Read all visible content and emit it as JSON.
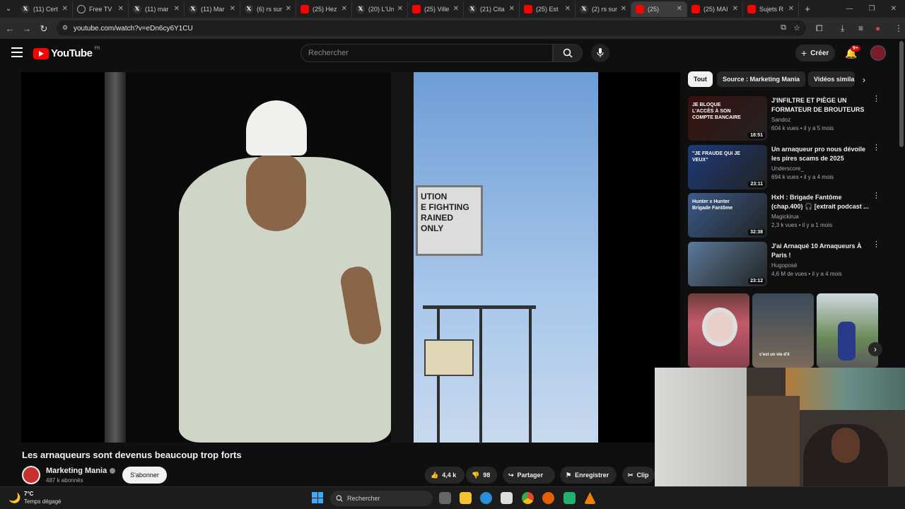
{
  "browser": {
    "tabs": [
      {
        "label": "(11) Cert",
        "icon": "x-icon"
      },
      {
        "label": "Free TV",
        "icon": "globe-icon"
      },
      {
        "label": "(11) mar",
        "icon": "x-icon"
      },
      {
        "label": "(11) Mar",
        "icon": "x-icon"
      },
      {
        "label": "(6) rs sur",
        "icon": "x-icon"
      },
      {
        "label": "(25) Hez",
        "icon": "youtube-icon"
      },
      {
        "label": "(20) L'Un",
        "icon": "x-icon"
      },
      {
        "label": "(25) Ville",
        "icon": "youtube-icon"
      },
      {
        "label": "(21) Cita",
        "icon": "x-icon"
      },
      {
        "label": "(25) Est",
        "icon": "youtube-icon"
      },
      {
        "label": "(2) rs sur",
        "icon": "x-icon"
      },
      {
        "label": "(25)",
        "icon": "youtube-icon"
      },
      {
        "label": "(25) MAI",
        "icon": "youtube-icon"
      },
      {
        "label": "Sujets R",
        "icon": "youtube-icon"
      }
    ],
    "url": "youtube.com/watch?v=eDn6cy6Y1CU"
  },
  "header": {
    "logo_text": "YouTube",
    "logo_region": "FR",
    "search_placeholder": "Rechercher",
    "create_label": "Créer",
    "notif_badge": "9+"
  },
  "video": {
    "sign_text": "UTION\nE FIGHTING\nRAINED\nONLY",
    "title": "Les arnaqueurs sont devenus beaucoup trop forts",
    "channel": "Marketing Mania",
    "subscribers": "487 k abonnés",
    "subscribe_label": "S'abonner",
    "likes": "4,4 k",
    "dislikes": "98",
    "share_label": "Partager",
    "save_label": "Enregistrer",
    "clip_label": "Clip"
  },
  "sidebar": {
    "chips": [
      "Tout",
      "Source : Marketing Mania",
      "Vidéos simila"
    ],
    "recommendations": [
      {
        "title": "J'INFILTRE ET PIÈGE UN FORMATEUR DE BROUTEURS",
        "channel": "Sandoz",
        "meta": "604 k vues • il y a 5 mois",
        "duration": "18:51",
        "thumb_text": "JE BLOQUE L'ACCÈS À SON COMPTE BANCAIRE",
        "thumb_color": "#3a1010"
      },
      {
        "title": "Un arnaqueur pro nous dévoile les pires scams de 2025",
        "channel": "Underscore_",
        "meta": "694 k vues • il y a 4 mois",
        "duration": "23:11",
        "thumb_text": "\"JE FRAUDE QUI JE VEUX\"",
        "thumb_color": "#1d3b7a"
      },
      {
        "title": "HxH : Brigade Fantôme (chap.400) 🎧 [extrait podcast ...",
        "channel": "Magickirua",
        "meta": "2,3 k vues • il y a 1 mois",
        "duration": "32:38",
        "thumb_text": "Hunter x Hunter Brigade Fantôme",
        "thumb_color": "#3a5a8a"
      },
      {
        "title": "J'ai Arnaqué 10 Arnaqueurs À Paris !",
        "channel": "Hugoposé",
        "meta": "4,6 M de vues • il y a 4 mois",
        "duration": "23:12",
        "thumb_text": "",
        "thumb_color": "#5a7a9a"
      }
    ],
    "shorts_caption": "c'est un vie d'il"
  },
  "taskbar": {
    "temp": "7°C",
    "weather": "Temps dégagé",
    "search_label": "Rechercher"
  }
}
